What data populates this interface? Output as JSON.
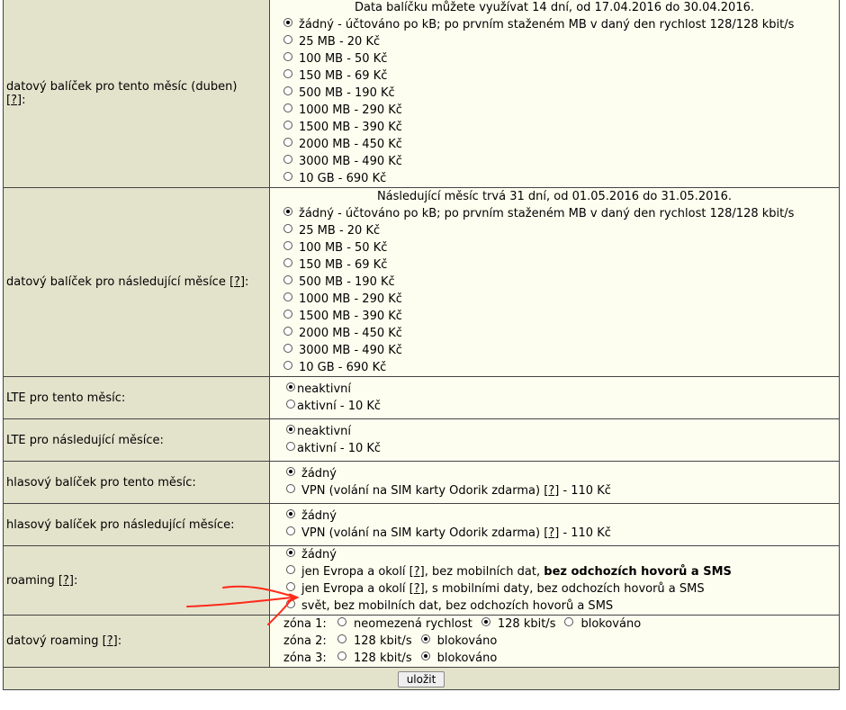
{
  "help_mark": "?",
  "data_this_month": {
    "label": "datový balíček pro tento měsíc (duben)",
    "label_suffix": ":",
    "info": "Data balíčku můžete využívat 14 dní, od 17.04.2016 do 30.04.2016.",
    "options": [
      "žádný - účtováno po kB; po prvním staženém MB v daný den rychlost 128/128 kbit/s",
      "25 MB - 20 Kč",
      "100 MB - 50 Kč",
      "150 MB - 69 Kč",
      "500 MB - 190 Kč",
      "1000 MB - 290 Kč",
      "1500 MB - 390 Kč",
      "2000 MB - 450 Kč",
      "3000 MB - 490 Kč",
      "10 GB - 690 Kč"
    ]
  },
  "data_next_months": {
    "label": "datový balíček pro následující měsíce",
    "label_suffix": ":",
    "info": "Následující měsíc trvá 31 dní, od 01.05.2016 do 31.05.2016.",
    "options": [
      "žádný - účtováno po kB; po prvním staženém MB v daný den rychlost 128/128 kbit/s",
      "25 MB - 20 Kč",
      "100 MB - 50 Kč",
      "150 MB - 69 Kč",
      "500 MB - 190 Kč",
      "1000 MB - 290 Kč",
      "1500 MB - 390 Kč",
      "2000 MB - 450 Kč",
      "3000 MB - 490 Kč",
      "10 GB - 690 Kč"
    ]
  },
  "lte_this_month": {
    "label": "LTE pro tento měsíc:",
    "options": [
      "neaktivní",
      "aktivní - 10 Kč"
    ]
  },
  "lte_next_months": {
    "label": "LTE pro následující měsíce:",
    "options": [
      "neaktivní",
      "aktivní - 10 Kč"
    ]
  },
  "voice_this_month": {
    "label": "hlasový balíček pro tento měsíc:",
    "option_none": "žádný",
    "option_vpn_pre": "VPN (volání na SIM karty Odorik zdarma)",
    "option_vpn_post": "- 110 Kč"
  },
  "voice_next_months": {
    "label": "hlasový balíček pro následující měsíce:",
    "option_none": "žádný",
    "option_vpn_pre": "VPN (volání na SIM karty Odorik zdarma)",
    "option_vpn_post": "- 110 Kč"
  },
  "roaming": {
    "label": "roaming",
    "label_suffix": ":",
    "option_none": "žádný",
    "option2_pre": "jen Evropa a okolí",
    "option2_mid": ", bez mobilních dat,",
    "option2_bold": "bez odchozích hovorů a SMS",
    "option3_pre": "jen Evropa a okolí",
    "option3_post": ", s mobilními daty, bez odchozích hovorů a SMS",
    "option4": "svět, bez mobilních dat, bez odchozích hovorů a SMS"
  },
  "data_roaming": {
    "label": "datový roaming",
    "label_suffix": ":",
    "zone1": {
      "label": "zóna 1:",
      "options": [
        "neomezená rychlost",
        "128 kbit/s",
        "blokováno"
      ]
    },
    "zone2": {
      "label": "zóna 2:",
      "options": [
        "128 kbit/s",
        "blokováno"
      ]
    },
    "zone3": {
      "label": "zóna 3:",
      "options": [
        "128 kbit/s",
        "blokováno"
      ]
    }
  },
  "save_button": "uložit",
  "annotation_color": "#ff2a1a"
}
